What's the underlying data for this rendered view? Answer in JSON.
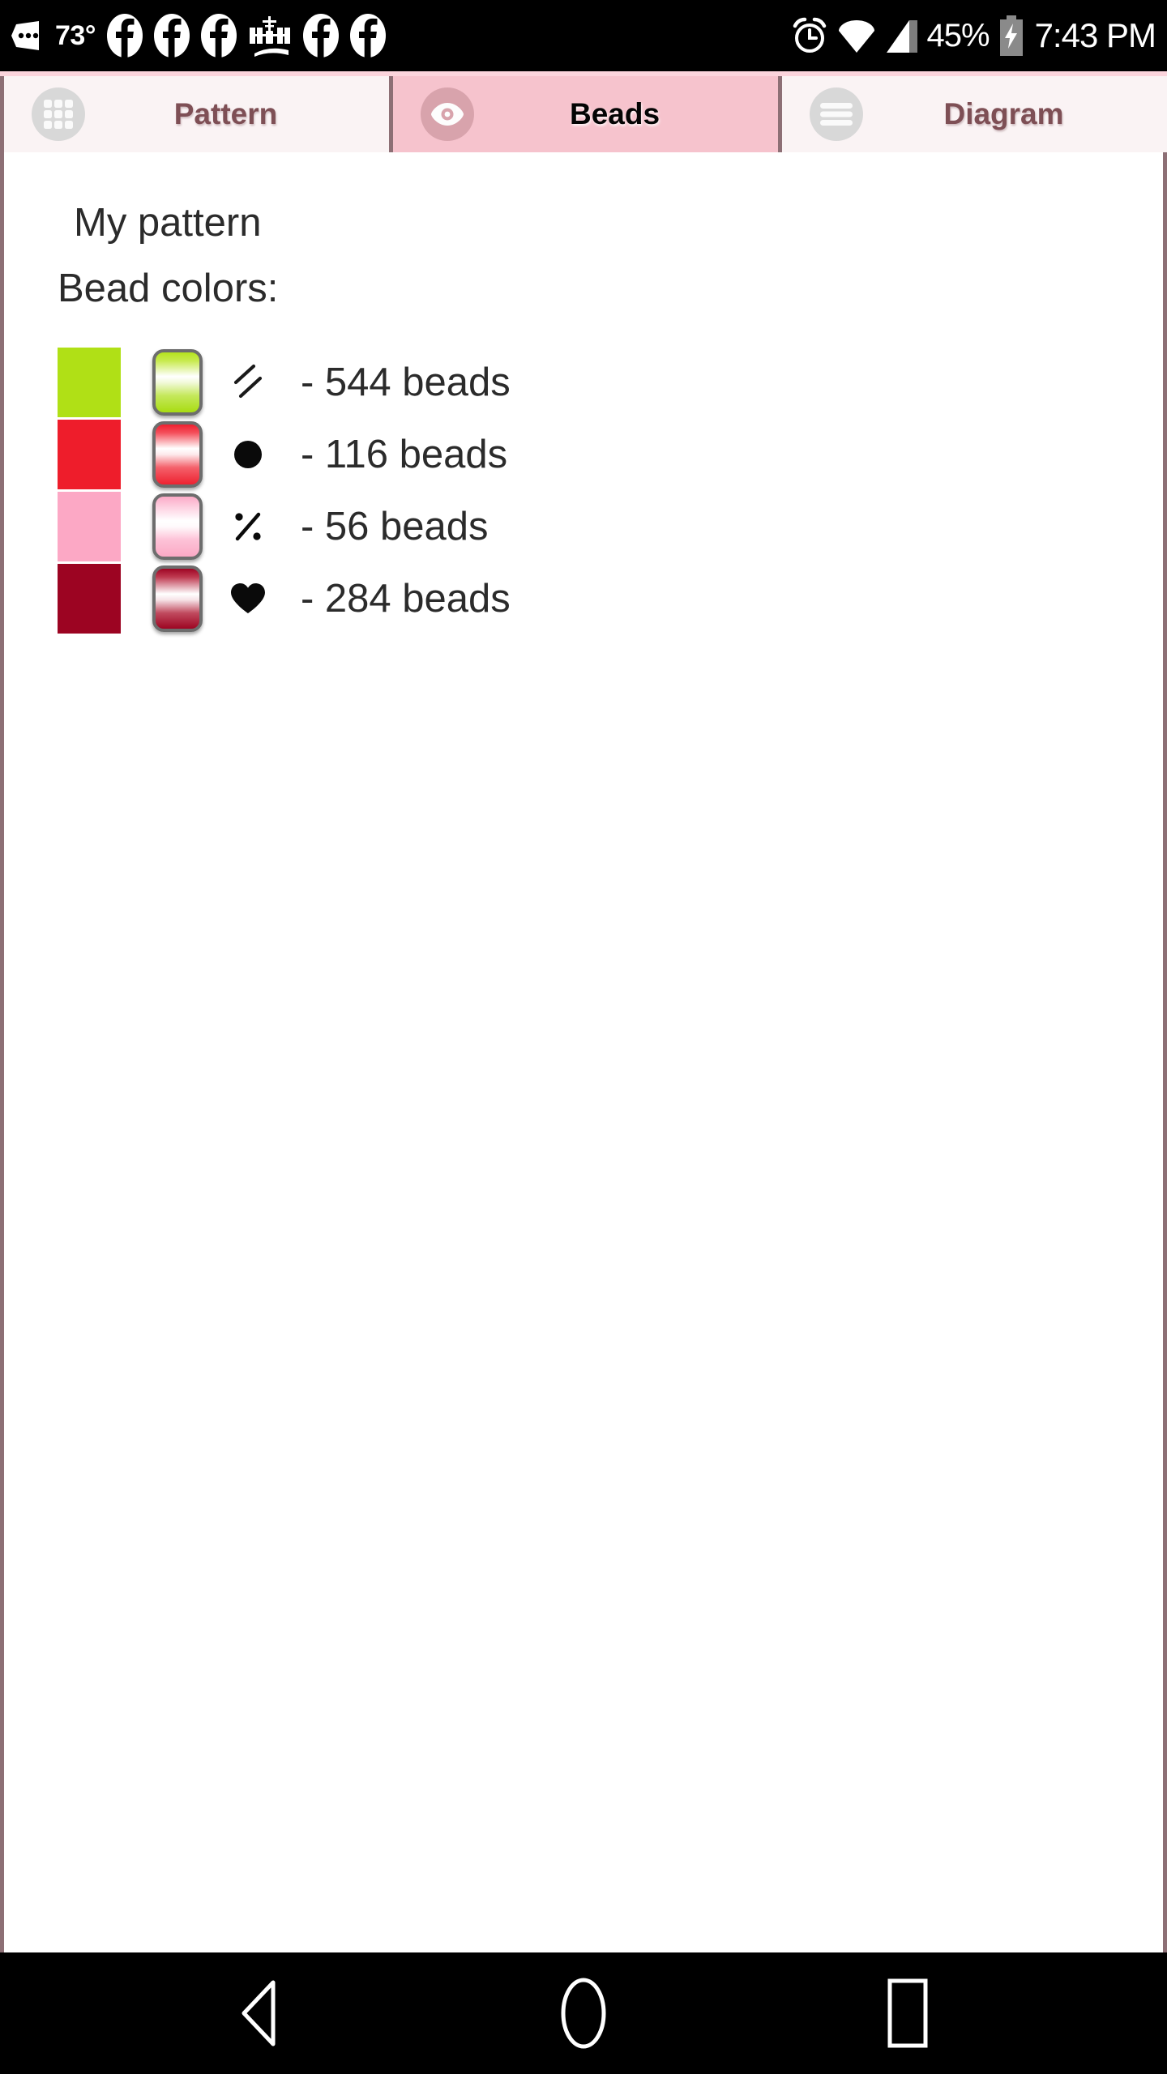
{
  "status_bar": {
    "temperature": "73°",
    "battery_percent": "45%",
    "clock": "7:43 PM",
    "left_icons": [
      {
        "name": "more-dots-icon"
      },
      {
        "name": "facebook-icon"
      },
      {
        "name": "facebook-icon"
      },
      {
        "name": "facebook-icon"
      },
      {
        "name": "space-station-icon"
      },
      {
        "name": "facebook-icon"
      },
      {
        "name": "facebook-icon"
      }
    ],
    "right_icons": [
      {
        "name": "alarm-clock-icon"
      },
      {
        "name": "wifi-icon"
      },
      {
        "name": "cell-signal-icon"
      },
      {
        "name": "battery-charging-icon"
      }
    ]
  },
  "tabs": [
    {
      "label": "Pattern",
      "icon": "grid-icon",
      "active": false
    },
    {
      "label": "Beads",
      "icon": "eye-icon",
      "active": true
    },
    {
      "label": "Diagram",
      "icon": "hamburger-icon",
      "active": false
    }
  ],
  "content": {
    "pattern_title": "My pattern",
    "bead_colors_label": "Bead colors:",
    "beads": [
      {
        "color": "#b0e016",
        "symbol": "double-slash",
        "count": "544",
        "text": "- 544 beads"
      },
      {
        "color": "#ee1d2b",
        "symbol": "filled-circle",
        "count": "116",
        "text": "- 116 beads"
      },
      {
        "color": "#fca8c5",
        "symbol": "percent",
        "count": "56",
        "text": "- 56 beads"
      },
      {
        "color": "#9c0422",
        "symbol": "heart",
        "count": "284",
        "text": "- 284 beads"
      }
    ]
  },
  "nav_bar": {
    "back_label": "Back",
    "home_label": "Home",
    "recents_label": "Recents"
  },
  "colors": {
    "tab_active_bg": "#f6c3cd",
    "tab_inactive_bg": "#faf3f4",
    "tab_label": "#7e4f55",
    "border": "#8d6f75"
  }
}
